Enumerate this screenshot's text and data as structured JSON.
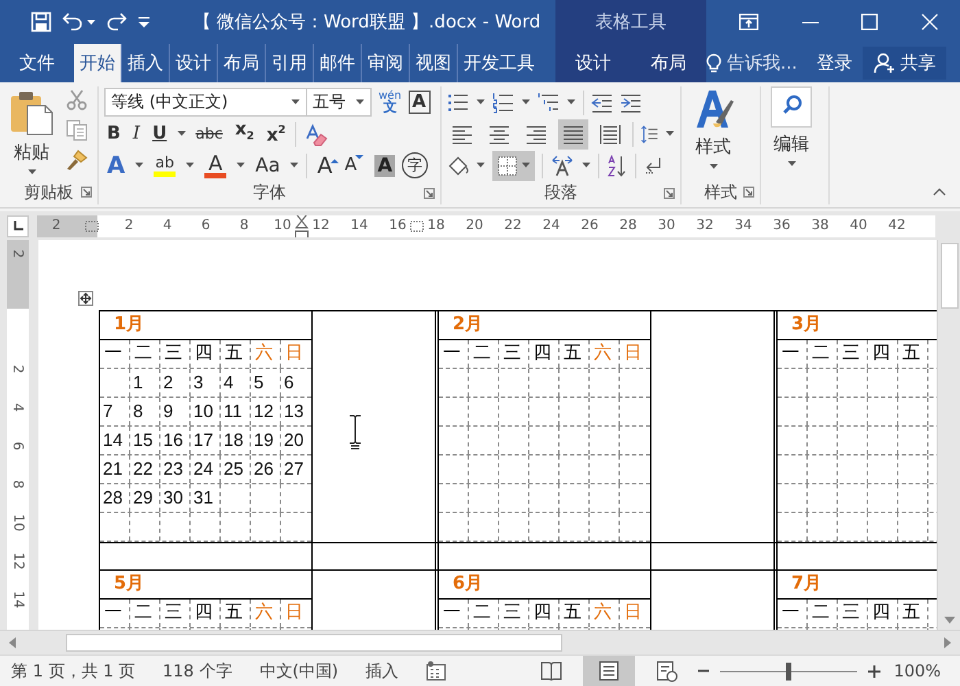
{
  "title_bar": {
    "title": "【 微信公众号：Word联盟 】.docx - Word",
    "contextual_label": "表格工具"
  },
  "tabs": [
    {
      "label": "文件",
      "selected": false
    },
    {
      "label": "开始",
      "selected": true
    },
    {
      "label": "插入",
      "selected": false
    },
    {
      "label": "设计",
      "selected": false
    },
    {
      "label": "布局",
      "selected": false
    },
    {
      "label": "引用",
      "selected": false
    },
    {
      "label": "邮件",
      "selected": false
    },
    {
      "label": "审阅",
      "selected": false
    },
    {
      "label": "视图",
      "selected": false
    },
    {
      "label": "开发工具",
      "selected": false
    }
  ],
  "contextual_tabs": [
    {
      "label": "设计",
      "selected": false
    },
    {
      "label": "布局",
      "selected": false
    }
  ],
  "tell_me": "告诉我...",
  "sign_in": "登录",
  "share": "共享",
  "ribbon": {
    "clipboard": {
      "paste": "粘贴",
      "label": "剪贴板"
    },
    "font": {
      "font_name": "等线 (中文正文)",
      "font_size": "五号",
      "phonetic_top": "wén",
      "phonetic_bottom": "文",
      "char_border": "A",
      "format_buttons": [
        {
          "kind": "bold",
          "label": "B"
        },
        {
          "kind": "italic",
          "label": "I"
        },
        {
          "kind": "underline",
          "label": "U",
          "dropdown": true
        },
        {
          "kind": "strike",
          "label": "abc"
        },
        {
          "kind": "subscript",
          "label": "x$_{2}$"
        },
        {
          "kind": "superscript",
          "label": "x$^{2}$"
        }
      ],
      "effect_buttons": [
        {
          "kind": "effects",
          "label": "A",
          "dropdown": true
        },
        {
          "kind": "highlight",
          "label": "ab",
          "color": "#ffff00",
          "dropdown": true
        },
        {
          "kind": "fontcolor",
          "label": "A",
          "color": "#e84c22",
          "dropdown": true
        },
        {
          "kind": "case",
          "label": "Aa",
          "dropdown": true
        }
      ],
      "size_buttons": [
        {
          "kind": "grow",
          "label": "A"
        },
        {
          "kind": "shrink",
          "label": "A"
        },
        {
          "kind": "shading",
          "label": "A"
        },
        {
          "kind": "enclose",
          "label": "字"
        }
      ],
      "label": "字体"
    },
    "paragraph": {
      "alignment": [
        {
          "kind": "left",
          "selected": false
        },
        {
          "kind": "center",
          "selected": false
        },
        {
          "kind": "right",
          "selected": false
        },
        {
          "kind": "justify",
          "selected": true
        },
        {
          "kind": "distributed",
          "selected": false
        }
      ],
      "borders": {
        "selected": true
      },
      "label": "段落"
    },
    "styles": {
      "button": "样式",
      "label": "样式"
    },
    "editing": {
      "button": "编辑"
    }
  },
  "ruler": {
    "labels": [
      "2",
      "2",
      "4",
      "6",
      "8",
      "10",
      "12",
      "14",
      "16",
      "18",
      "20",
      "22",
      "24",
      "26",
      "28",
      "30",
      "32",
      "34",
      "36",
      "38",
      "40",
      "42"
    ]
  },
  "vertical_ruler": {
    "labels": [
      "2",
      "2",
      "4",
      "6",
      "8",
      "10",
      "12",
      "14"
    ]
  },
  "calendar": {
    "rows": [
      [
        {
          "title": "1月",
          "weekdays": [
            {
              "label": "一",
              "color": "#000000"
            },
            {
              "label": "二",
              "color": "#000000"
            },
            {
              "label": "三",
              "color": "#000000"
            },
            {
              "label": "四",
              "color": "#000000"
            },
            {
              "label": "五",
              "color": "#000000"
            },
            {
              "label": "六",
              "color": "#e36c09"
            },
            {
              "label": "日",
              "color": "#e36c09"
            }
          ],
          "weeks": [
            {
              "kind": "end_aligned",
              "days": [
                "1",
                "2",
                "3",
                "4",
                "5",
                "6"
              ]
            },
            {
              "kind": "start_aligned",
              "days": [
                "7",
                "8",
                "9",
                "10",
                "11",
                "12",
                "13"
              ]
            },
            {
              "kind": "start_aligned",
              "days": [
                "14",
                "15",
                "16",
                "17",
                "18",
                "19",
                "20"
              ]
            },
            {
              "kind": "start_aligned",
              "days": [
                "21",
                "22",
                "23",
                "24",
                "25",
                "26",
                "27"
              ]
            },
            {
              "kind": "start_aligned",
              "days": [
                "28",
                "29",
                "30",
                "31"
              ]
            }
          ]
        },
        {
          "title": "2月",
          "weekdays": [
            {
              "label": "一",
              "color": "#000000"
            },
            {
              "label": "二",
              "color": "#000000"
            },
            {
              "label": "三",
              "color": "#000000"
            },
            {
              "label": "四",
              "color": "#000000"
            },
            {
              "label": "五",
              "color": "#000000"
            },
            {
              "label": "六",
              "color": "#e36c09"
            },
            {
              "label": "日",
              "color": "#e36c09"
            }
          ]
        },
        {
          "title": "3月",
          "weekdays": [
            {
              "label": "一",
              "color": "#000000"
            },
            {
              "label": "二",
              "color": "#000000"
            },
            {
              "label": "三",
              "color": "#000000"
            },
            {
              "label": "四",
              "color": "#000000"
            },
            {
              "label": "五",
              "color": "#000000"
            }
          ]
        }
      ],
      [
        {
          "title": "5月",
          "weekdays": [
            {
              "label": "一",
              "color": "#000000"
            },
            {
              "label": "二",
              "color": "#000000"
            },
            {
              "label": "三",
              "color": "#000000"
            },
            {
              "label": "四",
              "color": "#000000"
            },
            {
              "label": "五",
              "color": "#000000"
            },
            {
              "label": "六",
              "color": "#e36c09"
            },
            {
              "label": "日",
              "color": "#e36c09"
            }
          ]
        },
        {
          "title": "6月",
          "weekdays": [
            {
              "label": "一",
              "color": "#000000"
            },
            {
              "label": "二",
              "color": "#000000"
            },
            {
              "label": "三",
              "color": "#000000"
            },
            {
              "label": "四",
              "color": "#000000"
            },
            {
              "label": "五",
              "color": "#000000"
            },
            {
              "label": "六",
              "color": "#e36c09"
            },
            {
              "label": "日",
              "color": "#e36c09"
            }
          ]
        },
        {
          "title": "7月",
          "weekdays": [
            {
              "label": "一",
              "color": "#000000"
            },
            {
              "label": "二",
              "color": "#000000"
            },
            {
              "label": "三",
              "color": "#000000"
            },
            {
              "label": "四",
              "color": "#000000"
            },
            {
              "label": "五",
              "color": "#000000"
            }
          ]
        }
      ]
    ]
  },
  "status_bar": {
    "page": "第 1 页，共 1 页",
    "words": "118 个字",
    "language": "中文(中国)",
    "mode": "插入",
    "views": [
      {
        "kind": "read",
        "selected": false
      },
      {
        "kind": "print",
        "selected": true
      },
      {
        "kind": "web",
        "selected": false
      }
    ],
    "zoom": {
      "level": 0.5,
      "label": "100%"
    }
  }
}
